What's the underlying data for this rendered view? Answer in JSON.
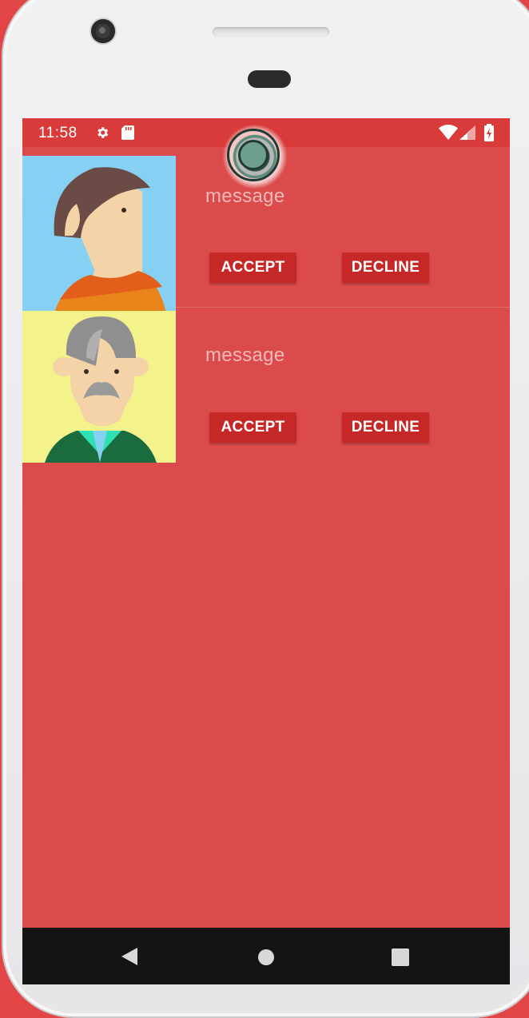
{
  "status_bar": {
    "time": "11:58",
    "left_icons": [
      "gear-icon",
      "sd-card-icon"
    ],
    "right_icons": [
      "wifi-icon",
      "signal-icon",
      "battery-charging-icon"
    ]
  },
  "colors": {
    "screen_bg": "#dc4b4b",
    "status_bar_bg": "#d93a3a",
    "button_bg": "#c62828",
    "message_text": "#f3b9b9"
  },
  "requests": [
    {
      "avatar": "avatar-young-man-icon",
      "message": "message",
      "accept_label": "ACCEPT",
      "decline_label": "DECLINE"
    },
    {
      "avatar": "avatar-old-man-icon",
      "message": "message",
      "accept_label": "ACCEPT",
      "decline_label": "DECLINE"
    }
  ],
  "nav_bar": {
    "buttons": [
      "back-icon",
      "home-icon",
      "recents-icon"
    ]
  },
  "overlay": {
    "icon": "floating-touch-indicator-icon"
  }
}
